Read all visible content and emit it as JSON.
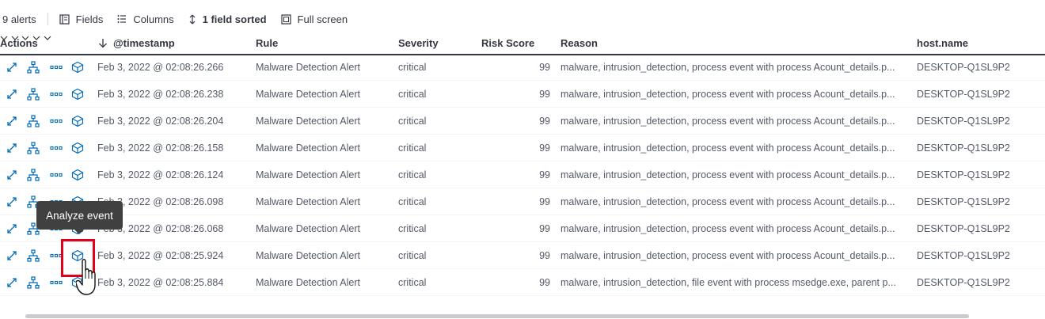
{
  "toolbar": {
    "alert_count": "9 alerts",
    "fields_label": "Fields",
    "columns_label": "Columns",
    "sorted_label": "1 field sorted",
    "fullscreen_label": "Full screen"
  },
  "columns": {
    "actions": "Actions",
    "timestamp": "@timestamp",
    "rule": "Rule",
    "severity": "Severity",
    "risk_score": "Risk Score",
    "reason": "Reason",
    "host_name": "host.name"
  },
  "rows": [
    {
      "timestamp": "Feb 3, 2022 @ 02:08:26.266",
      "rule": "Malware Detection Alert",
      "severity": "critical",
      "risk_score": "99",
      "reason": "malware, intrusion_detection, process event with process Acount_details.p...",
      "host_name": "DESKTOP-Q1SL9P2"
    },
    {
      "timestamp": "Feb 3, 2022 @ 02:08:26.238",
      "rule": "Malware Detection Alert",
      "severity": "critical",
      "risk_score": "99",
      "reason": "malware, intrusion_detection, process event with process Acount_details.p...",
      "host_name": "DESKTOP-Q1SL9P2"
    },
    {
      "timestamp": "Feb 3, 2022 @ 02:08:26.204",
      "rule": "Malware Detection Alert",
      "severity": "critical",
      "risk_score": "99",
      "reason": "malware, intrusion_detection, process event with process Acount_details.p...",
      "host_name": "DESKTOP-Q1SL9P2"
    },
    {
      "timestamp": "Feb 3, 2022 @ 02:08:26.158",
      "rule": "Malware Detection Alert",
      "severity": "critical",
      "risk_score": "99",
      "reason": "malware, intrusion_detection, process event with process Acount_details.p...",
      "host_name": "DESKTOP-Q1SL9P2"
    },
    {
      "timestamp": "Feb 3, 2022 @ 02:08:26.124",
      "rule": "Malware Detection Alert",
      "severity": "critical",
      "risk_score": "99",
      "reason": "malware, intrusion_detection, process event with process Acount_details.p...",
      "host_name": "DESKTOP-Q1SL9P2"
    },
    {
      "timestamp": "Feb 3, 2022 @ 02:08:26.098",
      "rule": "Malware Detection Alert",
      "severity": "critical",
      "risk_score": "99",
      "reason": "malware, intrusion_detection, process event with process Acount_details.p...",
      "host_name": "DESKTOP-Q1SL9P2"
    },
    {
      "timestamp": "Feb 3, 2022 @ 02:08:26.068",
      "rule": "Malware Detection Alert",
      "severity": "critical",
      "risk_score": "99",
      "reason": "malware, intrusion_detection, process event with process Acount_details.p...",
      "host_name": "DESKTOP-Q1SL9P2"
    },
    {
      "timestamp": "Feb 3, 2022 @ 02:08:25.924",
      "rule": "Malware Detection Alert",
      "severity": "critical",
      "risk_score": "99",
      "reason": "malware, intrusion_detection, process event with process Acount_details.p...",
      "host_name": "DESKTOP-Q1SL9P2"
    },
    {
      "timestamp": "Feb 3, 2022 @ 02:08:25.884",
      "rule": "Malware Detection Alert",
      "severity": "critical",
      "risk_score": "99",
      "reason": "malware, intrusion_detection, file event with process msedge.exe, parent p...",
      "host_name": "DESKTOP-Q1SL9P2"
    }
  ],
  "row_actions": {
    "expand": "expand-icon",
    "investigate": "timeline-icon",
    "more": "more-icon",
    "analyze": "analyze-event-icon"
  },
  "tooltip": {
    "text": "Analyze event"
  },
  "colors": {
    "link_blue": "#006bb8",
    "highlight_red": "#e3001b",
    "tooltip_bg": "#404040"
  }
}
